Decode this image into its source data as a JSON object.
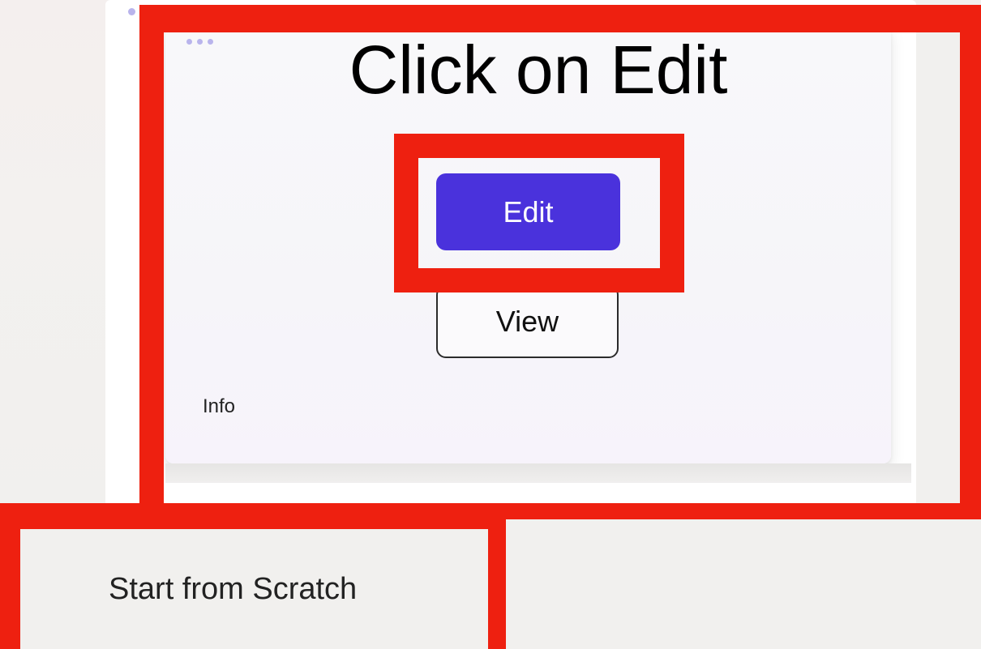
{
  "annotation": {
    "caption": "Click on Edit",
    "highlight_color": "#ee2010"
  },
  "card": {
    "more_icon": "more-horizontal-icon",
    "edit_label": "Edit",
    "view_label": "View",
    "info_label": "Info",
    "accent_color": "#4a32dc"
  },
  "below": {
    "start_label": "Start from Scratch"
  }
}
